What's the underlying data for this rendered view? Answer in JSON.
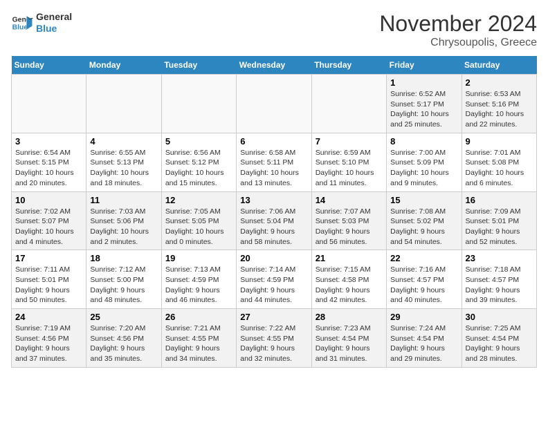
{
  "header": {
    "logo_line1": "General",
    "logo_line2": "Blue",
    "month": "November 2024",
    "location": "Chrysoupolis, Greece"
  },
  "weekdays": [
    "Sunday",
    "Monday",
    "Tuesday",
    "Wednesday",
    "Thursday",
    "Friday",
    "Saturday"
  ],
  "weeks": [
    [
      {
        "day": "",
        "info": ""
      },
      {
        "day": "",
        "info": ""
      },
      {
        "day": "",
        "info": ""
      },
      {
        "day": "",
        "info": ""
      },
      {
        "day": "",
        "info": ""
      },
      {
        "day": "1",
        "info": "Sunrise: 6:52 AM\nSunset: 5:17 PM\nDaylight: 10 hours\nand 25 minutes."
      },
      {
        "day": "2",
        "info": "Sunrise: 6:53 AM\nSunset: 5:16 PM\nDaylight: 10 hours\nand 22 minutes."
      }
    ],
    [
      {
        "day": "3",
        "info": "Sunrise: 6:54 AM\nSunset: 5:15 PM\nDaylight: 10 hours\nand 20 minutes."
      },
      {
        "day": "4",
        "info": "Sunrise: 6:55 AM\nSunset: 5:13 PM\nDaylight: 10 hours\nand 18 minutes."
      },
      {
        "day": "5",
        "info": "Sunrise: 6:56 AM\nSunset: 5:12 PM\nDaylight: 10 hours\nand 15 minutes."
      },
      {
        "day": "6",
        "info": "Sunrise: 6:58 AM\nSunset: 5:11 PM\nDaylight: 10 hours\nand 13 minutes."
      },
      {
        "day": "7",
        "info": "Sunrise: 6:59 AM\nSunset: 5:10 PM\nDaylight: 10 hours\nand 11 minutes."
      },
      {
        "day": "8",
        "info": "Sunrise: 7:00 AM\nSunset: 5:09 PM\nDaylight: 10 hours\nand 9 minutes."
      },
      {
        "day": "9",
        "info": "Sunrise: 7:01 AM\nSunset: 5:08 PM\nDaylight: 10 hours\nand 6 minutes."
      }
    ],
    [
      {
        "day": "10",
        "info": "Sunrise: 7:02 AM\nSunset: 5:07 PM\nDaylight: 10 hours\nand 4 minutes."
      },
      {
        "day": "11",
        "info": "Sunrise: 7:03 AM\nSunset: 5:06 PM\nDaylight: 10 hours\nand 2 minutes."
      },
      {
        "day": "12",
        "info": "Sunrise: 7:05 AM\nSunset: 5:05 PM\nDaylight: 10 hours\nand 0 minutes."
      },
      {
        "day": "13",
        "info": "Sunrise: 7:06 AM\nSunset: 5:04 PM\nDaylight: 9 hours\nand 58 minutes."
      },
      {
        "day": "14",
        "info": "Sunrise: 7:07 AM\nSunset: 5:03 PM\nDaylight: 9 hours\nand 56 minutes."
      },
      {
        "day": "15",
        "info": "Sunrise: 7:08 AM\nSunset: 5:02 PM\nDaylight: 9 hours\nand 54 minutes."
      },
      {
        "day": "16",
        "info": "Sunrise: 7:09 AM\nSunset: 5:01 PM\nDaylight: 9 hours\nand 52 minutes."
      }
    ],
    [
      {
        "day": "17",
        "info": "Sunrise: 7:11 AM\nSunset: 5:01 PM\nDaylight: 9 hours\nand 50 minutes."
      },
      {
        "day": "18",
        "info": "Sunrise: 7:12 AM\nSunset: 5:00 PM\nDaylight: 9 hours\nand 48 minutes."
      },
      {
        "day": "19",
        "info": "Sunrise: 7:13 AM\nSunset: 4:59 PM\nDaylight: 9 hours\nand 46 minutes."
      },
      {
        "day": "20",
        "info": "Sunrise: 7:14 AM\nSunset: 4:59 PM\nDaylight: 9 hours\nand 44 minutes."
      },
      {
        "day": "21",
        "info": "Sunrise: 7:15 AM\nSunset: 4:58 PM\nDaylight: 9 hours\nand 42 minutes."
      },
      {
        "day": "22",
        "info": "Sunrise: 7:16 AM\nSunset: 4:57 PM\nDaylight: 9 hours\nand 40 minutes."
      },
      {
        "day": "23",
        "info": "Sunrise: 7:18 AM\nSunset: 4:57 PM\nDaylight: 9 hours\nand 39 minutes."
      }
    ],
    [
      {
        "day": "24",
        "info": "Sunrise: 7:19 AM\nSunset: 4:56 PM\nDaylight: 9 hours\nand 37 minutes."
      },
      {
        "day": "25",
        "info": "Sunrise: 7:20 AM\nSunset: 4:56 PM\nDaylight: 9 hours\nand 35 minutes."
      },
      {
        "day": "26",
        "info": "Sunrise: 7:21 AM\nSunset: 4:55 PM\nDaylight: 9 hours\nand 34 minutes."
      },
      {
        "day": "27",
        "info": "Sunrise: 7:22 AM\nSunset: 4:55 PM\nDaylight: 9 hours\nand 32 minutes."
      },
      {
        "day": "28",
        "info": "Sunrise: 7:23 AM\nSunset: 4:54 PM\nDaylight: 9 hours\nand 31 minutes."
      },
      {
        "day": "29",
        "info": "Sunrise: 7:24 AM\nSunset: 4:54 PM\nDaylight: 9 hours\nand 29 minutes."
      },
      {
        "day": "30",
        "info": "Sunrise: 7:25 AM\nSunset: 4:54 PM\nDaylight: 9 hours\nand 28 minutes."
      }
    ]
  ]
}
